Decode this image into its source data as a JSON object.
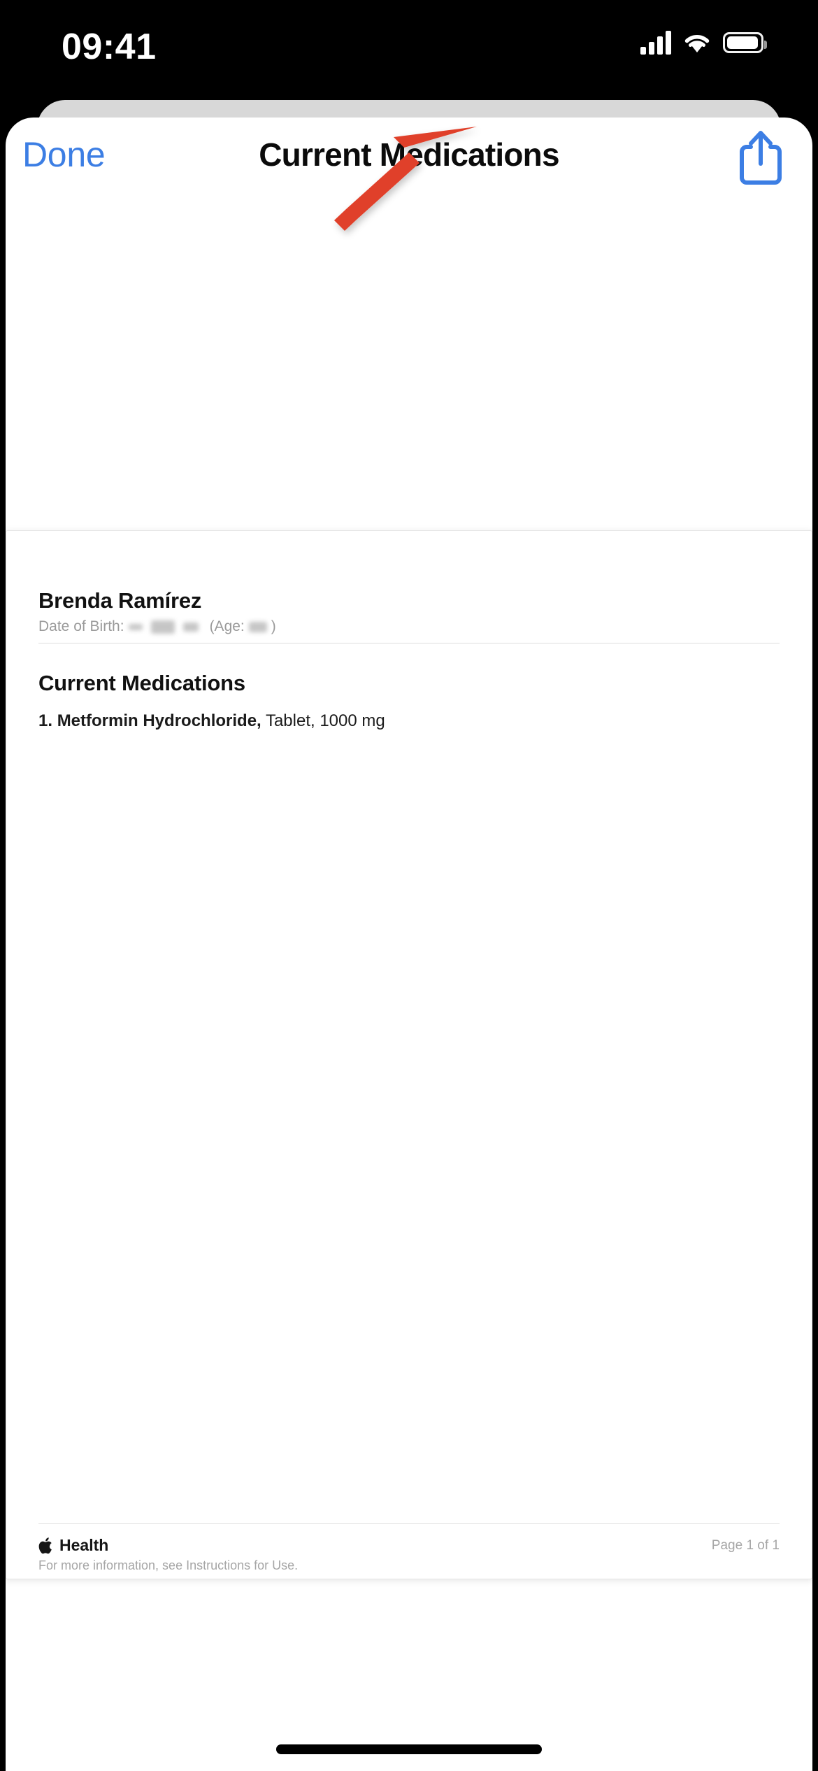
{
  "status_bar": {
    "time": "09:41",
    "signal_icon": "cellular-signal-icon",
    "wifi_icon": "wifi-icon",
    "battery_icon": "battery-full-icon"
  },
  "nav_bar": {
    "done_label": "Done",
    "title": "Current Medications",
    "share_icon": "share-icon",
    "accent_color": "#3c7ee4"
  },
  "annotation": {
    "arrow_icon": "red-arrow-pointing-to-share-button",
    "color": "#e0412a"
  },
  "document": {
    "patient_name": "Brenda Ramírez",
    "dob_label": "Date of Birth:",
    "dob_value": "",
    "age_open": "(Age:",
    "age_close": ")",
    "section_title": "Current Medications",
    "medications": [
      {
        "index": "1.",
        "name": "Metformin Hydrochloride,",
        "details": "Tablet, 1000 mg"
      }
    ],
    "footer": {
      "apple_icon": "apple-logo-icon",
      "brand": "Health",
      "note": "For more information, see Instructions for Use.",
      "page": "Page 1 of 1"
    }
  },
  "home_indicator": "home-indicator"
}
